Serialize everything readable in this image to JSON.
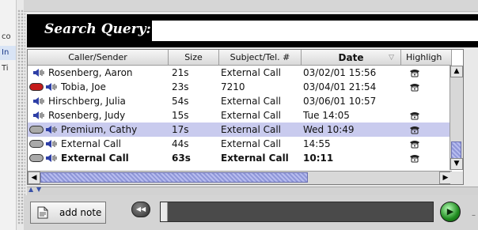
{
  "left_panel": {
    "items": [
      "co",
      "In",
      "Ti"
    ]
  },
  "search": {
    "label": "Search Query:",
    "value": ""
  },
  "table": {
    "columns": [
      "Caller/Sender",
      "Size",
      "Subject/Tel. #",
      "Date",
      "Highligh"
    ],
    "sorted_column": "Date",
    "rows": [
      {
        "caller": "Rosenberg, Aaron",
        "size": "21s",
        "subject": "External Call",
        "date": "03/02/01 15:56",
        "badge": "",
        "phone": true,
        "selected": false,
        "bold": false
      },
      {
        "caller": "Tobia, Joe",
        "size": "23s",
        "subject": "7210",
        "date": "03/04/01 21:54",
        "badge": "red",
        "phone": true,
        "selected": false,
        "bold": false
      },
      {
        "caller": "Hirschberg, Julia",
        "size": "54s",
        "subject": "External Call",
        "date": "03/06/01 10:57",
        "badge": "",
        "phone": false,
        "selected": false,
        "bold": false
      },
      {
        "caller": "Rosenberg, Judy",
        "size": "15s",
        "subject": "External Call",
        "date": "Tue 14:05",
        "badge": "",
        "phone": true,
        "selected": false,
        "bold": false
      },
      {
        "caller": "Premium, Cathy",
        "size": "17s",
        "subject": "External Call",
        "date": "Wed 10:49",
        "badge": "gray",
        "phone": true,
        "selected": true,
        "bold": false
      },
      {
        "caller": "External Call",
        "size": "44s",
        "subject": "External Call",
        "date": "14:55",
        "badge": "gray",
        "phone": true,
        "selected": false,
        "bold": false
      },
      {
        "caller": "External Call",
        "size": "63s",
        "subject": "External Call",
        "date": "10:11",
        "badge": "gray",
        "phone": true,
        "selected": false,
        "bold": true
      }
    ]
  },
  "buttons": {
    "add_note": "add note"
  },
  "colors": {
    "selection": "#c9cbee",
    "scroll_thumb": "#8f97d8",
    "play": "#1e8a1e",
    "header_bg": "#000000"
  },
  "icons": {
    "speaker": "speaker-icon",
    "phone": "phone-icon",
    "note": "note-icon",
    "rewind": "rewind-icon",
    "play": "play-icon"
  }
}
